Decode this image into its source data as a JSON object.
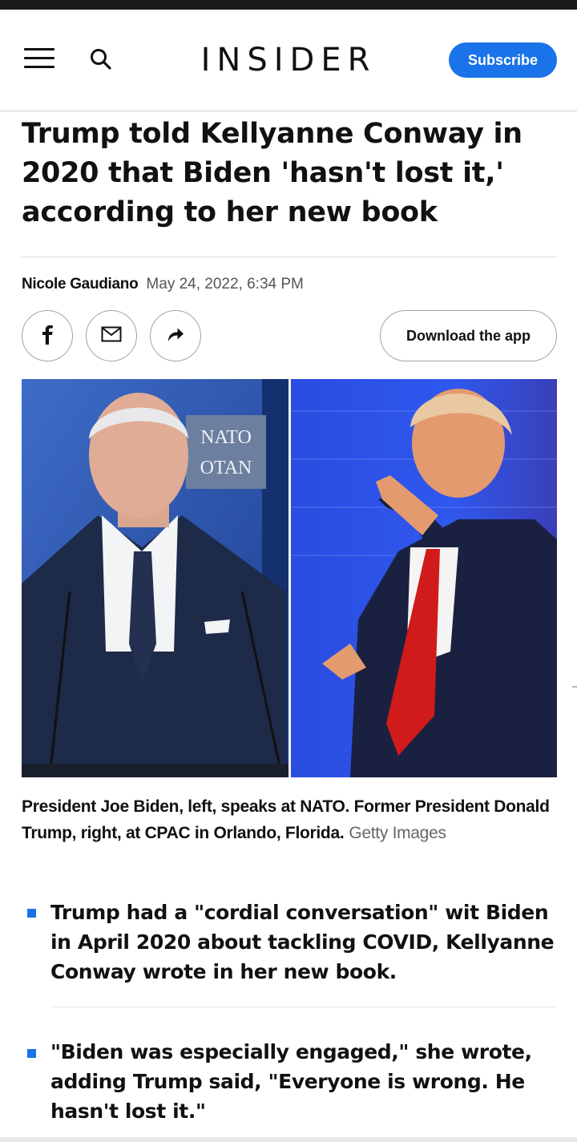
{
  "header": {
    "logo": "INSIDER",
    "subscribe_label": "Subscribe"
  },
  "article": {
    "headline": "Trump told Kellyanne Conway in 2020 that Biden 'hasn't lost it,' according to her new book",
    "author": "Nicole Gaudiano",
    "date": "May 24, 2022, 6:34 PM",
    "share": {
      "download_label": "Download the app",
      "icons": [
        "facebook-icon",
        "mail-icon",
        "share-icon"
      ]
    },
    "photo": {
      "sign_line1": "NATO",
      "sign_line2": "OTAN"
    },
    "caption": "President Joe Biden, left, speaks at NATO. Former President Donald Trump, right, at CPAC in Orlando, Florida.",
    "credit": "Getty Images",
    "bullets": [
      "Trump had a \"cordial conversation\" wit Biden in April 2020 about tackling COVID, Kellyanne Conway wrote in her new book.",
      "\"Biden was especially engaged,\" she wrote, adding Trump said, \"Everyone is wrong. He hasn't lost it.\""
    ]
  },
  "colors": {
    "accent": "#1a73e8",
    "text": "#111111",
    "muted": "#555555",
    "divider": "#dde2e4"
  }
}
